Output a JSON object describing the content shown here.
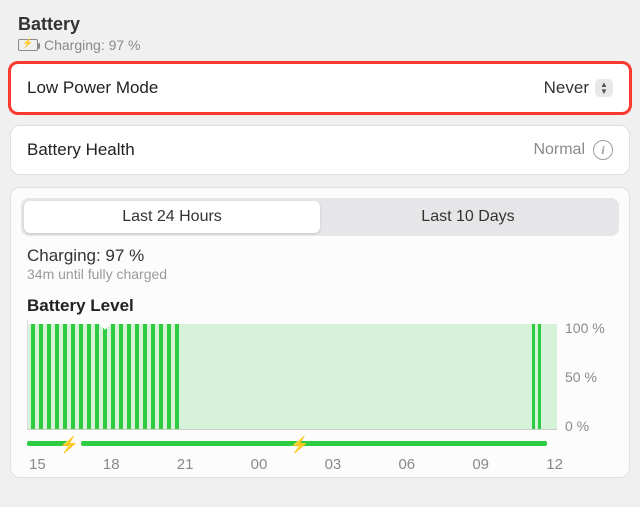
{
  "header": {
    "title": "Battery",
    "status": "Charging: 97 %"
  },
  "low_power_mode": {
    "label": "Low Power Mode",
    "value": "Never"
  },
  "battery_health": {
    "label": "Battery Health",
    "value": "Normal"
  },
  "segmented": {
    "left": "Last 24 Hours",
    "right": "Last 10 Days"
  },
  "charging_block": {
    "line1": "Charging: 97 %",
    "line2": "34m until fully charged"
  },
  "chart_title": "Battery Level",
  "yaxis": {
    "max": "100 %",
    "mid": "50 %",
    "min": "0 %"
  },
  "xaxis": [
    "15",
    "18",
    "21",
    "00",
    "03",
    "06",
    "09",
    "12"
  ],
  "chart_data": {
    "type": "area",
    "title": "Battery Level",
    "ylabel": "",
    "xlabel": "",
    "ylim": [
      0,
      100
    ],
    "x": [
      "15",
      "16",
      "17",
      "18",
      "19",
      "20",
      "21",
      "22",
      "23",
      "00",
      "01",
      "02",
      "03",
      "04",
      "05",
      "06",
      "07",
      "08",
      "09",
      "10",
      "11",
      "12",
      "13"
    ],
    "series": [
      {
        "name": "Battery Level",
        "values": [
          100,
          95,
          92,
          95,
          100,
          100,
          100,
          100,
          100,
          100,
          100,
          100,
          100,
          100,
          100,
          100,
          100,
          100,
          100,
          100,
          100,
          100,
          100
        ]
      }
    ],
    "charging_intervals": [
      "15-15.5",
      "16-03",
      "03-12.5"
    ],
    "annotations": [
      "charging-bolt@15.5",
      "charging-bolt@03"
    ]
  }
}
